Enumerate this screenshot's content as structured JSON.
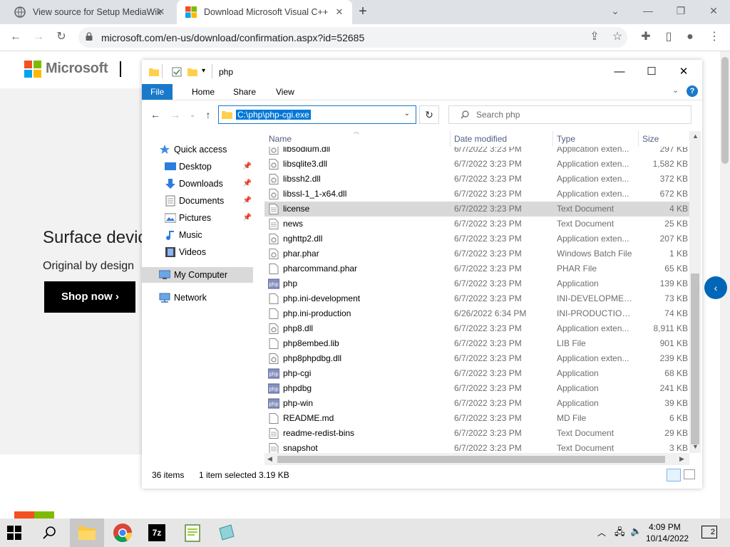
{
  "browser": {
    "tabs": [
      {
        "title": "View source for Setup MediaWik"
      },
      {
        "title": "Download Microsoft Visual C++"
      }
    ],
    "new_tab": "+",
    "url": "microsoft.com/en-us/download/confirmation.aspx?id=52685"
  },
  "webpage": {
    "brand": "Microsoft",
    "hero_title": "Surface device",
    "hero_sub": "Original by design",
    "shop_button": "Shop now ›"
  },
  "explorer": {
    "window_title": "php",
    "ribbon_tabs": [
      "File",
      "Home",
      "Share",
      "View"
    ],
    "address": "C:\\php\\php-cgi.exe",
    "search_placeholder": "Search php",
    "nav": {
      "quick_access": "Quick access",
      "items": [
        "Desktop",
        "Downloads",
        "Documents",
        "Pictures",
        "Music",
        "Videos"
      ],
      "my_computer": "My Computer",
      "network": "Network"
    },
    "columns": [
      "Name",
      "Date modified",
      "Type",
      "Size"
    ],
    "files": [
      {
        "name": "libsodium.dll",
        "date": "6/7/2022 3:23 PM",
        "type": "Application exten...",
        "size": "297 KB",
        "icon": "dll"
      },
      {
        "name": "libsqlite3.dll",
        "date": "6/7/2022 3:23 PM",
        "type": "Application exten...",
        "size": "1,582 KB",
        "icon": "dll"
      },
      {
        "name": "libssh2.dll",
        "date": "6/7/2022 3:23 PM",
        "type": "Application exten...",
        "size": "372 KB",
        "icon": "dll"
      },
      {
        "name": "libssl-1_1-x64.dll",
        "date": "6/7/2022 3:23 PM",
        "type": "Application exten...",
        "size": "672 KB",
        "icon": "dll"
      },
      {
        "name": "license",
        "date": "6/7/2022 3:23 PM",
        "type": "Text Document",
        "size": "4 KB",
        "icon": "txt",
        "selected": true
      },
      {
        "name": "news",
        "date": "6/7/2022 3:23 PM",
        "type": "Text Document",
        "size": "25 KB",
        "icon": "txt"
      },
      {
        "name": "nghttp2.dll",
        "date": "6/7/2022 3:23 PM",
        "type": "Application exten...",
        "size": "207 KB",
        "icon": "dll"
      },
      {
        "name": "phar.phar",
        "date": "6/7/2022 3:23 PM",
        "type": "Windows Batch File",
        "size": "1 KB",
        "icon": "dll"
      },
      {
        "name": "pharcommand.phar",
        "date": "6/7/2022 3:23 PM",
        "type": "PHAR File",
        "size": "65 KB",
        "icon": "blank"
      },
      {
        "name": "php",
        "date": "6/7/2022 3:23 PM",
        "type": "Application",
        "size": "139 KB",
        "icon": "php"
      },
      {
        "name": "php.ini-development",
        "date": "6/7/2022 3:23 PM",
        "type": "INI-DEVELOPMEN...",
        "size": "73 KB",
        "icon": "blank"
      },
      {
        "name": "php.ini-production",
        "date": "6/26/2022 6:34 PM",
        "type": "INI-PRODUCTION ...",
        "size": "74 KB",
        "icon": "blank"
      },
      {
        "name": "php8.dll",
        "date": "6/7/2022 3:23 PM",
        "type": "Application exten...",
        "size": "8,911 KB",
        "icon": "dll"
      },
      {
        "name": "php8embed.lib",
        "date": "6/7/2022 3:23 PM",
        "type": "LIB File",
        "size": "901 KB",
        "icon": "blank"
      },
      {
        "name": "php8phpdbg.dll",
        "date": "6/7/2022 3:23 PM",
        "type": "Application exten...",
        "size": "239 KB",
        "icon": "dll"
      },
      {
        "name": "php-cgi",
        "date": "6/7/2022 3:23 PM",
        "type": "Application",
        "size": "68 KB",
        "icon": "php"
      },
      {
        "name": "phpdbg",
        "date": "6/7/2022 3:23 PM",
        "type": "Application",
        "size": "241 KB",
        "icon": "php"
      },
      {
        "name": "php-win",
        "date": "6/7/2022 3:23 PM",
        "type": "Application",
        "size": "39 KB",
        "icon": "php"
      },
      {
        "name": "README.md",
        "date": "6/7/2022 3:23 PM",
        "type": "MD File",
        "size": "6 KB",
        "icon": "blank"
      },
      {
        "name": "readme-redist-bins",
        "date": "6/7/2022 3:23 PM",
        "type": "Text Document",
        "size": "29 KB",
        "icon": "txt"
      },
      {
        "name": "snapshot",
        "date": "6/7/2022 3:23 PM",
        "type": "Text Document",
        "size": "3 KB",
        "icon": "txt"
      }
    ],
    "status": {
      "count": "36 items",
      "selected": "1 item selected",
      "size": "3.19 KB"
    }
  },
  "taskbar": {
    "time": "4:09 PM",
    "date": "10/14/2022",
    "notifications": "2"
  },
  "colors": {
    "accent": "#1979ca",
    "selection": "#d9d9d9",
    "ms_blue": "#0067b8"
  }
}
